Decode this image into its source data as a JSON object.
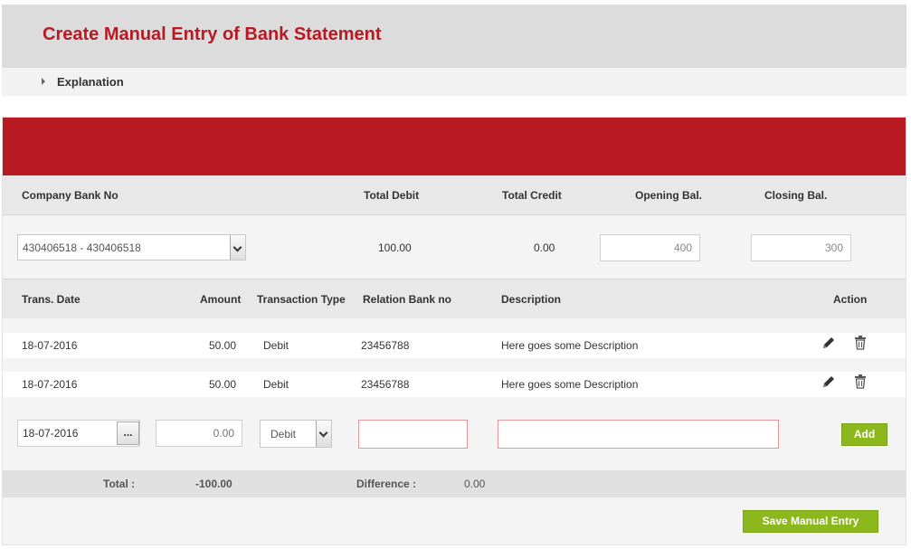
{
  "page": {
    "title": "Create Manual Entry of Bank Statement",
    "explanation_label": "Explanation"
  },
  "summary": {
    "headers": {
      "company_bank_no": "Company Bank No",
      "total_debit": "Total Debit",
      "total_credit": "Total Credit",
      "opening_bal": "Opening Bal.",
      "closing_bal": "Closing Bal."
    },
    "company_bank_selected": "430406518 - 430406518",
    "total_debit": "100.00",
    "total_credit": "0.00",
    "opening_bal": "400",
    "closing_bal": "300"
  },
  "transactions": {
    "headers": {
      "trans_date": "Trans. Date",
      "amount": "Amount",
      "transaction_type": "Transaction Type",
      "relation_bank_no": "Relation Bank no",
      "description": "Description",
      "action": "Action"
    },
    "rows": [
      {
        "date": "18-07-2016",
        "amount": "50.00",
        "type": "Debit",
        "relation_bank_no": "23456788",
        "description": "Here goes some Description"
      },
      {
        "date": "18-07-2016",
        "amount": "50.00",
        "type": "Debit",
        "relation_bank_no": "23456788",
        "description": "Here goes some Description"
      }
    ]
  },
  "new_entry": {
    "date": "18-07-2016",
    "date_picker_label": "...",
    "amount_placeholder": "0.00",
    "type_selected": "Debit",
    "relation_bank_no": "",
    "description": "",
    "add_label": "Add"
  },
  "totals": {
    "total_label": "Total :",
    "total_value": "-100.00",
    "difference_label": "Difference :",
    "difference_value": "0.00"
  },
  "actions": {
    "save_label": "Save Manual Entry"
  },
  "colors": {
    "brand_red": "#b81a24",
    "button_green": "#8cb81e"
  },
  "icons": {
    "row_edit": "pencil-icon",
    "row_delete": "trash-icon",
    "explanation_toggle": "caret-right-icon"
  }
}
